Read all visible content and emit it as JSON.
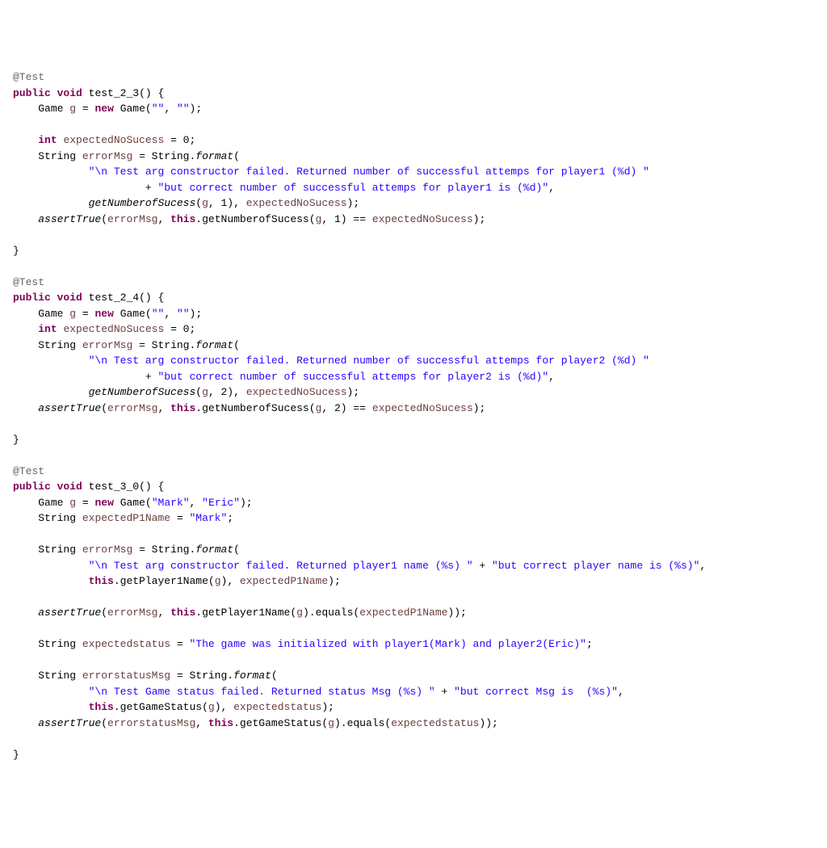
{
  "chart_data": null,
  "tokens": {
    "annot_test": "@Test",
    "kw_public": "public",
    "kw_void": "void",
    "kw_int": "int",
    "kw_new": "new",
    "kw_this": "this",
    "type_game": "Game",
    "type_string": "String",
    "method1": "test_2_3",
    "method2": "test_2_4",
    "method3": "test_3_0",
    "var_g": "g",
    "var_expectedNoSucess": "expectedNoSucess",
    "var_errorMsg": "errorMsg",
    "var_expectedP1Name": "expectedP1Name",
    "var_expectedstatus": "expectedstatus",
    "var_errorstatusMsg": "errorstatusMsg",
    "call_format": "format",
    "call_assertTrue": "assertTrue",
    "call_getNumberofSucess": "getNumberofSucess",
    "call_getPlayer1Name": "getPlayer1Name",
    "call_getGameStatus": "getGameStatus",
    "call_equals": "equals",
    "str_empty": "\"\"",
    "str_mark": "\"Mark\"",
    "str_eric": "\"Eric\"",
    "num_zero": "0",
    "num_one": "1",
    "num_two": "2",
    "str_p1_part1": "\"\\n Test arg constructor failed. Returned number of successful attemps for player1 (%d) \"",
    "str_p1_part2": "\"but correct number of successful attemps for player1 is (%d)\"",
    "str_p2_part1": "\"\\n Test arg constructor failed. Returned number of successful attemps for player2 (%d) \"",
    "str_p2_part2": "\"but correct number of successful attemps for player2 is (%d)\"",
    "str_name_part1": "\"\\n Test arg constructor failed. Returned player1 name (%s) \"",
    "str_name_part2": "\"but correct player name is (%s)\"",
    "str_expectedstatus": "\"The game was initialized with player1(Mark) and player2(Eric)\"",
    "str_status_part1": "\"\\n Test Game status failed. Returned status Msg (%s) \"",
    "str_status_part2": "\"but correct Msg is  (%s)\"",
    "lparen": "(",
    "rparen": ")",
    "lbrace": "{",
    "rbrace": "}",
    "semi": ";",
    "comma": ", ",
    "eq": " = ",
    "dot": ".",
    "plus": " + ",
    "deq": " == "
  }
}
